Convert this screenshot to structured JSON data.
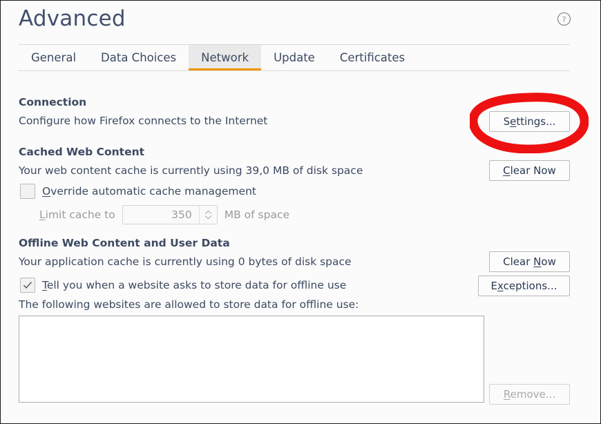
{
  "header": {
    "title": "Advanced",
    "help_icon": "help-circle-icon"
  },
  "tabs": [
    {
      "label": "General",
      "active": false
    },
    {
      "label": "Data Choices",
      "active": false
    },
    {
      "label": "Network",
      "active": true
    },
    {
      "label": "Update",
      "active": false
    },
    {
      "label": "Certificates",
      "active": false
    }
  ],
  "connection": {
    "heading": "Connection",
    "description": "Configure how Firefox connects to the Internet",
    "settings_button": {
      "pre": "S",
      "accel": "e",
      "post": "ttings..."
    }
  },
  "cached_web_content": {
    "heading": "Cached Web Content",
    "description": "Your web content cache is currently using 39,0 MB of disk space",
    "clear_button": {
      "pre": "",
      "accel": "C",
      "post": "lear Now"
    },
    "override_checkbox": {
      "checked": false,
      "pre": "",
      "accel": "O",
      "post": "verride automatic cache management"
    },
    "limit": {
      "label_pre": "",
      "label_accel": "L",
      "label_post": "imit cache to",
      "value": "350",
      "unit": "MB of space",
      "disabled": true
    }
  },
  "offline_web_content": {
    "heading": "Offline Web Content and User Data",
    "description": "Your application cache is currently using 0 bytes of disk space",
    "clear_button": {
      "pre": "Clear ",
      "accel": "N",
      "post": "ow"
    },
    "exceptions_button": {
      "pre": "E",
      "accel": "x",
      "post": "ceptions..."
    },
    "notify_checkbox": {
      "checked": true,
      "pre": "",
      "accel": "T",
      "post": "ell you when a website asks to store data for offline use"
    },
    "list_label": "The following websites are allowed to store data for offline use:",
    "sites": [],
    "remove_button": {
      "pre": "",
      "accel": "R",
      "post": "emove...",
      "disabled": true
    }
  },
  "annotation": {
    "shape": "red-ellipse",
    "color": "#ee1111",
    "target": "settings-button"
  },
  "colors": {
    "accent": "#f09300",
    "text": "#3d4a61",
    "background": "#fbfbfb",
    "annotation": "#ee1111"
  }
}
